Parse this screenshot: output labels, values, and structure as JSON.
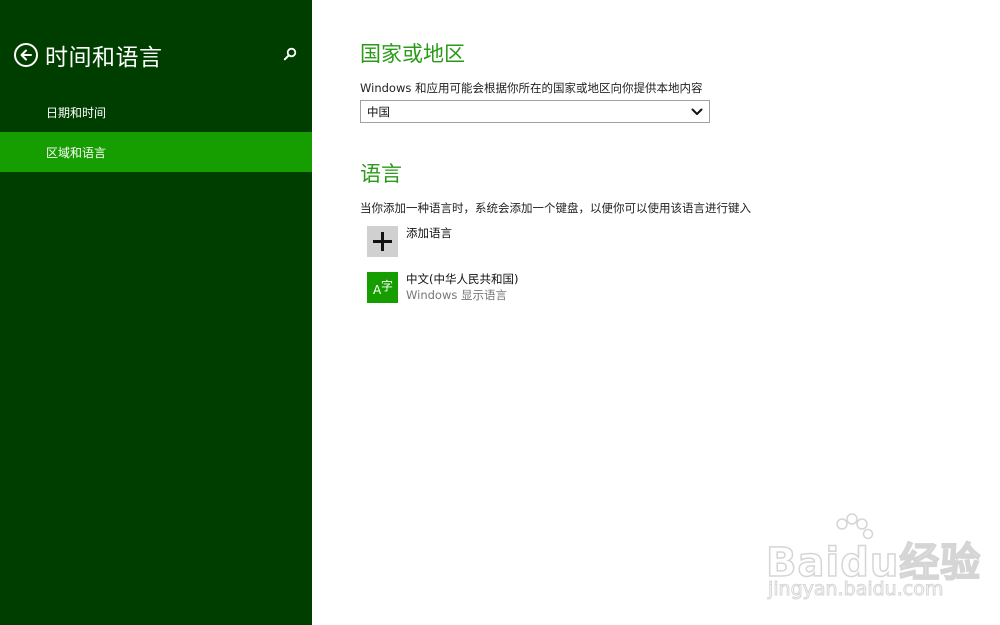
{
  "sidebar": {
    "title": "时间和语言",
    "items": [
      {
        "label": "日期和时间",
        "selected": false
      },
      {
        "label": "区域和语言",
        "selected": true
      }
    ]
  },
  "region": {
    "heading": "国家或地区",
    "description": "Windows 和应用可能会根据你所在的国家或地区向你提供本地内容",
    "selected_value": "中国"
  },
  "language": {
    "heading": "语言",
    "description": "当你添加一种语言时，系统会添加一个键盘，以便你可以使用该语言进行键入",
    "add_label": "添加语言",
    "installed": [
      {
        "name": "中文(中华人民共和国)",
        "subtitle": "Windows 显示语言",
        "icon": "language-char-icon"
      }
    ]
  },
  "watermark": {
    "brand": "Baidu经验",
    "url": "jingyan.baidu.com"
  },
  "colors": {
    "sidebar_bg": "#003e00",
    "selected_item_bg": "#169e00",
    "accent_heading": "#2a9a18",
    "add_tile_bg": "#d0d0d0"
  }
}
